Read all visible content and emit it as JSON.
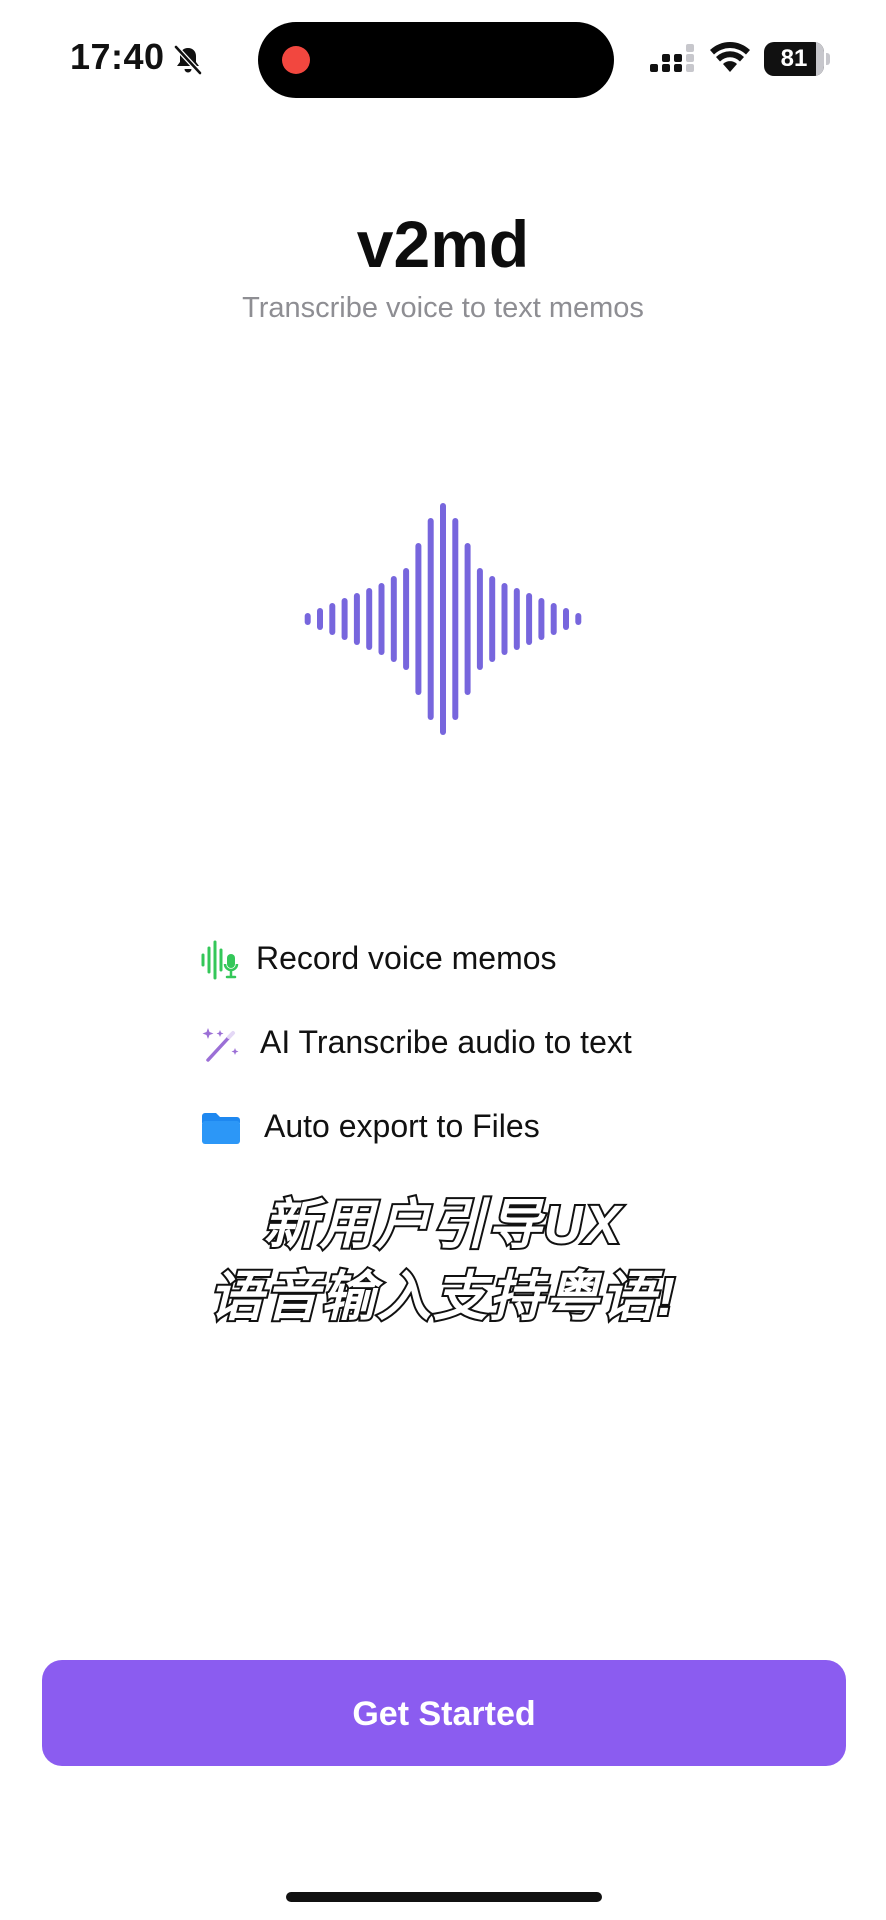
{
  "status_bar": {
    "time": "17:40",
    "battery": "81"
  },
  "header": {
    "title": "v2md",
    "subtitle": "Transcribe voice to text memos"
  },
  "features": [
    {
      "icon": "waveform-mic-icon",
      "label": "Record voice memos"
    },
    {
      "icon": "magic-wand-icon",
      "label": "AI Transcribe audio to text"
    },
    {
      "icon": "folder-icon",
      "label": "Auto export to Files"
    }
  ],
  "caption": {
    "line1": "新用户引导UX",
    "line2": "语音输入支持粤语!"
  },
  "cta": {
    "label": "Get Started"
  },
  "colors": {
    "accent": "#8b5cf0",
    "waveform": "#7766dd",
    "feature_green": "#34c759",
    "feature_purple": "#9b6fd6",
    "feature_blue": "#1e88f0",
    "subtitle_gray": "#8e8e93",
    "recording_red": "#f2473f"
  }
}
